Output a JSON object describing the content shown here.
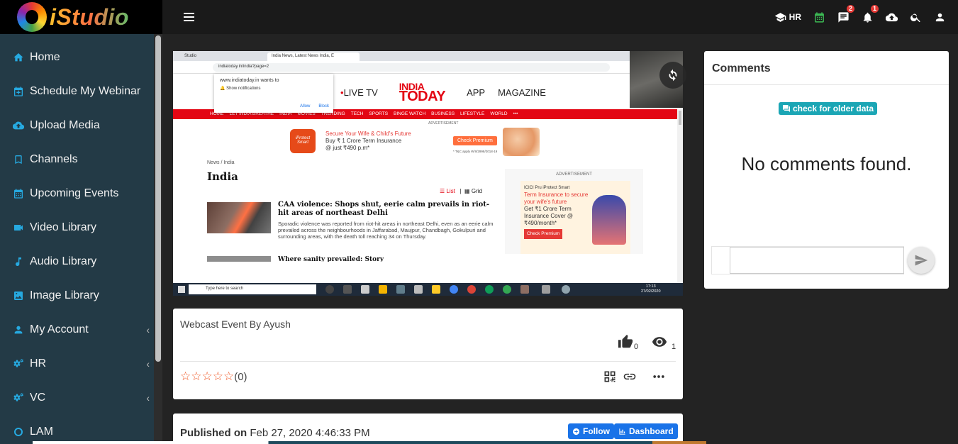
{
  "app": {
    "logo_text": "iStudio"
  },
  "topbar": {
    "hr_label": "HR",
    "messages_badge": "2",
    "notifications_badge": "1"
  },
  "sidebar": {
    "items": [
      {
        "label": "Home",
        "icon": "home-icon"
      },
      {
        "label": "Schedule My Webinar",
        "icon": "calendar-plus-icon"
      },
      {
        "label": "Upload Media",
        "icon": "cloud-upload-icon"
      },
      {
        "label": "Channels",
        "icon": "bookmark-icon"
      },
      {
        "label": "Upcoming Events",
        "icon": "calendar-icon"
      },
      {
        "label": "Video Library",
        "icon": "video-icon"
      },
      {
        "label": "Audio Library",
        "icon": "music-icon"
      },
      {
        "label": "Image Library",
        "icon": "image-icon"
      },
      {
        "label": "My Account",
        "icon": "user-icon",
        "expandable": true
      },
      {
        "label": "HR",
        "icon": "cogs-icon",
        "expandable": true
      },
      {
        "label": "VC",
        "icon": "cogs-icon",
        "expandable": true
      },
      {
        "label": "LAM",
        "icon": "circle-icon"
      }
    ]
  },
  "video": {
    "browser": {
      "tab1": "Studio",
      "tab2": "India News, Latest News India, E",
      "url": "indiatoday.in/india?page=2"
    },
    "notification_popup": {
      "text": "www.indiatoday.in wants to",
      "option": "Show notifications",
      "allow": "Allow",
      "block": "Block"
    },
    "site": {
      "live_tv": "LIVE TV",
      "logo_line1": "INDIA",
      "logo_line2": "TODAY",
      "app": "APP",
      "magazine": "MAGAZINE",
      "nav": [
        "HOME",
        "LET INDIA BREATHE",
        "INDIA",
        "MOVIES",
        "TRENDING",
        "TECH",
        "SPORTS",
        "BINGE WATCH",
        "BUSINESS",
        "LIFESTYLE",
        "WORLD",
        "•••"
      ],
      "ad_label": "ADVERTISEMENT",
      "ad1_brand": "iProtect Smart",
      "ad1_line1": "Secure Your Wife & Child's Future",
      "ad1_line2": "Buy ₹ 1 Crore Term Insurance",
      "ad1_line3": "@ just ₹490 p.m*",
      "ad1_cta": "Check Premium",
      "ad1_fine": "* T&C apply  W/II/2998/2018-19",
      "breadcrumb": "News / India",
      "heading": "India",
      "list_label": "List",
      "grid_label": "Grid",
      "article_title": "CAA violence: Shops shut, eerie calm prevails in riot-hit areas of northeast Delhi",
      "article_body": "Sporadic violence was reported from riot-hit areas in northeast Delhi, even as an eerie calm prevailed across the neighbourhoods in Jaffarabad, Maujpur, Chandbagh, Gokulpuri and surrounding areas, with the death toll reaching 34 on Thursday.",
      "article2_title": "Where sanity prevailed: Story",
      "ad2_label": "ADVERTISEMENT",
      "ad2_brand": "ICICI Pru iProtect Smart",
      "ad2_line1": "Term Insurance to secure your wife's future",
      "ad2_line2": "Get ₹1 Crore Term Insurance Cover @ ₹490/month*",
      "ad2_cta": "Check Premium"
    },
    "taskbar": {
      "search_placeholder": "Type here to search",
      "time": "17:13",
      "date": "27/02/2020"
    }
  },
  "event": {
    "title": "Webcast Event By Ayush",
    "likes": "0",
    "views": "1",
    "stars": "☆☆☆☆☆",
    "rating_count": "(0)"
  },
  "published": {
    "label": "Published on",
    "date": "Feb 27, 2020 4:46:33 PM",
    "follow": "Follow",
    "dashboard": "Dashboard"
  },
  "comments": {
    "title": "Comments",
    "older_button": "check for older data",
    "empty_text": "No comments found.",
    "input_placeholder": ""
  }
}
